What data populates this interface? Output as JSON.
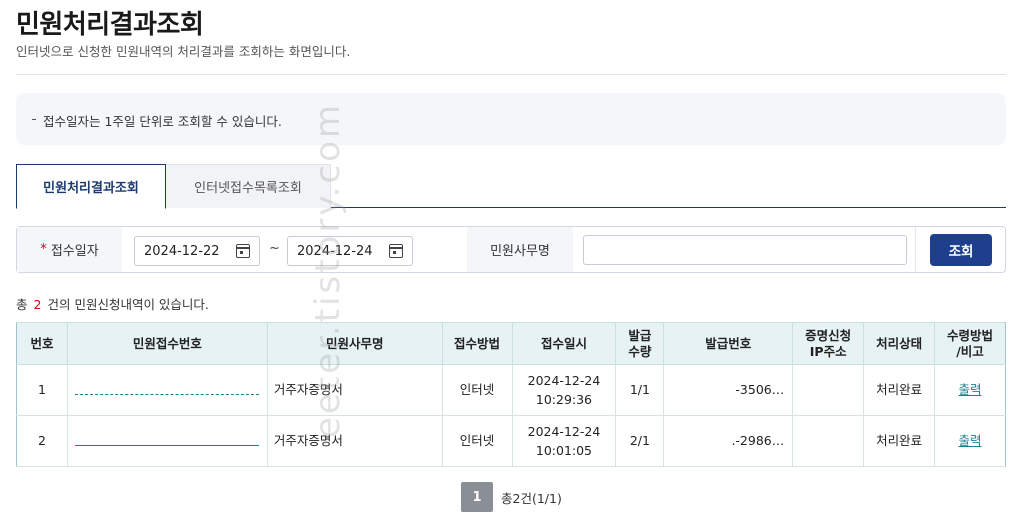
{
  "page": {
    "title": "민원처리결과조회",
    "subtitle": "인터넷으로 신청한 민원내역의 처리결과를 조회하는 화면입니다."
  },
  "notice": {
    "text": "접수일자는 1주일 단위로 조회할 수 있습니다."
  },
  "tabs": [
    {
      "label": "민원처리결과조회",
      "active": true
    },
    {
      "label": "인터넷접수목록조회",
      "active": false
    }
  ],
  "search": {
    "required_mark": "*",
    "date_label": "접수일자",
    "date_start": "2024-12-22",
    "date_end": "2024-12-24",
    "range_separator": "~",
    "office_label": "민원사무명",
    "office_value": "",
    "submit_label": "조회"
  },
  "result_summary": {
    "prefix": "총",
    "count": "2",
    "suffix": "건의 민원신청내역이 있습니다."
  },
  "table": {
    "headers": [
      "번호",
      "민원접수번호",
      "민원사무명",
      "접수방법",
      "접수일시",
      "발급\n수량",
      "발급번호",
      "증명신청\nIP주소",
      "처리상태",
      "수령방법\n/비고"
    ],
    "rows": [
      {
        "no": "1",
        "receipt_no": "",
        "office": "거주자증명서",
        "method": "인터넷",
        "date": "2024-12-24",
        "time": "10:29:36",
        "qty": "1/1",
        "issue_no": "-3506…",
        "ip": "",
        "status": "처리완료",
        "action": "출력"
      },
      {
        "no": "2",
        "receipt_no": "",
        "office": "거주자증명서",
        "method": "인터넷",
        "date": "2024-12-24",
        "time": "10:01:05",
        "qty": "2/1",
        "issue_no": ".-2986…",
        "ip": "",
        "status": "처리완료",
        "action": "출력"
      }
    ]
  },
  "pagination": {
    "current": "1",
    "total_text": "총2건(1/1)"
  },
  "watermark": {
    "text": "eeter.tistory.com"
  },
  "colors": {
    "primary": "#1d3f8e",
    "accent_red": "#d0021b",
    "link_teal": "#1d7f8e",
    "table_header_bg": "#e6f2f3"
  }
}
